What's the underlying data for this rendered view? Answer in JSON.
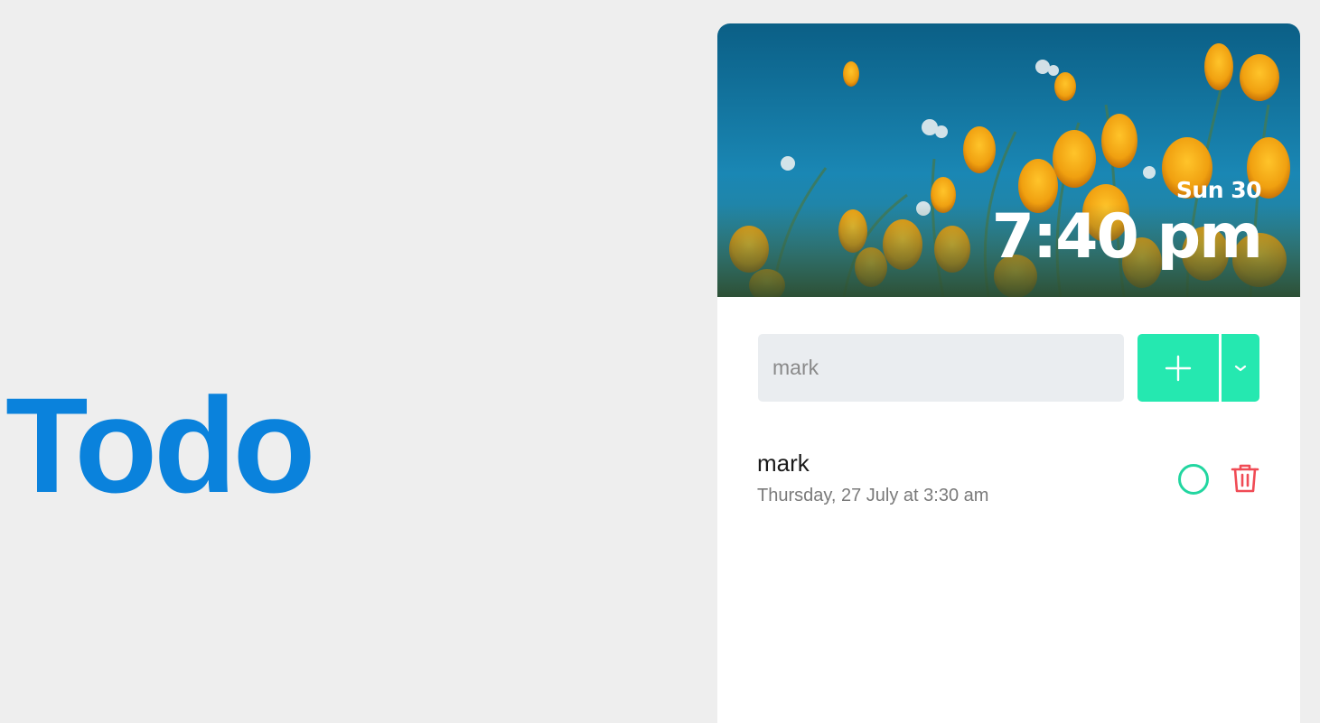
{
  "brand": {
    "title": "Todo",
    "color": "#0a82dc"
  },
  "header": {
    "date": "Sun 30",
    "time": "7:40 pm"
  },
  "composer": {
    "input_value": "mark",
    "add_icon": "plus-icon",
    "dropdown_icon": "chevron-down-icon",
    "accent": "#25e8b0"
  },
  "todos": [
    {
      "title": "mark",
      "timestamp": "Thursday, 27 July at 3:30 am",
      "completed": false,
      "complete_icon": "circle-icon",
      "delete_icon": "trash-icon",
      "delete_color": "#f04b55"
    }
  ]
}
